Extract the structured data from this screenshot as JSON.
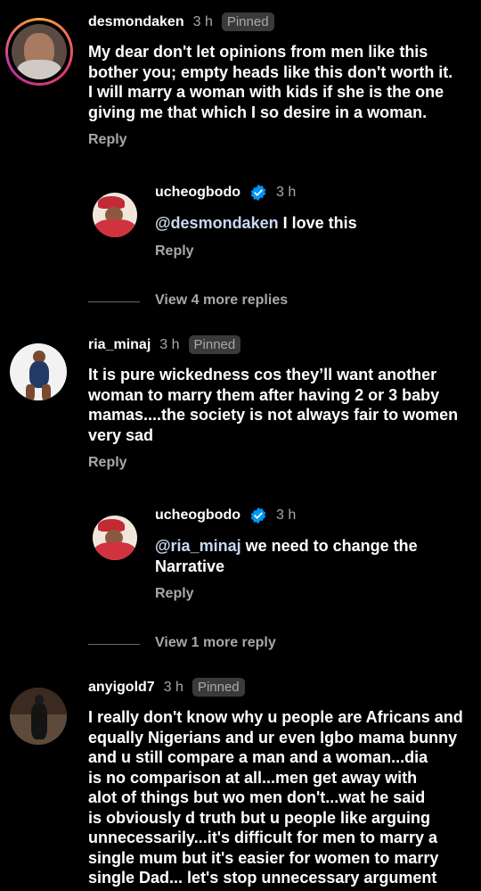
{
  "comments": [
    {
      "username": "desmondaken",
      "time": "3 h",
      "badge": "Pinned",
      "lines": [
        "My dear don't let opinions from men like this",
        "bother you; empty heads like this don't worth it.",
        "I will marry a woman with kids if she is the one",
        "giving me that which I so desire in a woman."
      ],
      "reply_label": "Reply",
      "reply": {
        "username": "ucheogbodo",
        "time": "3 h",
        "mention": "@desmondaken",
        "text": " I love this",
        "reply_label": "Reply"
      },
      "view_more": "View 4 more replies"
    },
    {
      "username": "ria_minaj",
      "time": "3 h",
      "badge": "Pinned",
      "lines": [
        "It is pure wickedness cos they’ll want another",
        "woman to marry them after having 2 or 3 baby",
        "mamas....the society is not always fair to women",
        "very sad"
      ],
      "reply_label": "Reply",
      "reply": {
        "username": "ucheogbodo",
        "time": "3 h",
        "mention": "@ria_minaj",
        "text": " we need to change the",
        "text2": "Narrative",
        "reply_label": "Reply"
      },
      "view_more": "View 1 more reply"
    },
    {
      "username": "anyigold7",
      "time": "3 h",
      "badge": "Pinned",
      "lines": [
        "I really don't know why u people are Africans and",
        "equally Nigerians and ur even Igbo mama bunny",
        "and u still compare a man and a woman...dia",
        "is no comparison at all...men get away with",
        "alot of things but wo men don't...wat he said",
        "is obviously d truth but u people like arguing",
        "unnecessarily...it's difficult for men to marry a",
        "single mum but it's easier for women to marry",
        "single Dad... let's stop unnecessary argument"
      ]
    }
  ],
  "colors": {
    "background": "#000000",
    "secondary_text": "#a8a8a8",
    "mention": "#c8d9f2",
    "verified": "#0095f6",
    "story_ring_start": "#f9a23a",
    "story_ring_end": "#c22fa3"
  },
  "icons": [
    "verified-badge-icon"
  ]
}
